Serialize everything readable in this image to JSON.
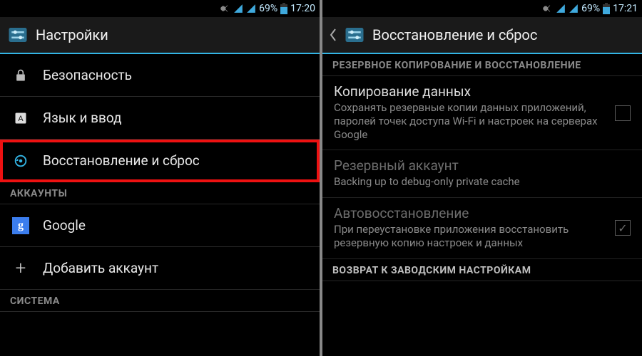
{
  "left": {
    "statusbar": {
      "battery": "69%",
      "time": "17:20"
    },
    "title": "Настройки",
    "rows": {
      "security": "Безопасность",
      "language": "Язык и ввод",
      "backup_reset": "Восстановление и сброс"
    },
    "cat_accounts": "АККАУНТЫ",
    "account_google": "Google",
    "add_account": "Добавить аккаунт",
    "cat_system": "СИСТЕМА"
  },
  "right": {
    "statusbar": {
      "battery": "69%",
      "time": "17:21"
    },
    "title": "Восстановление и сброс",
    "cat_backup": "РЕЗЕРВНОЕ КОПИРОВАНИЕ И ВОССТАНОВЛЕНИЕ",
    "backup_data": {
      "title": "Копирование данных",
      "summary": "Сохранять резервные копии данных приложений, паролей точек доступа Wi-Fi и настроек на серверах Google"
    },
    "backup_account": {
      "title": "Резервный аккаунт",
      "summary": "Backing up to debug-only private cache"
    },
    "auto_restore": {
      "title": "Автовосстановление",
      "summary": "При переустановке приложения восстановить резервную копию настроек и данных"
    },
    "cat_reset": "ВОЗВРАТ К ЗАВОДСКИМ НАСТРОЙКАМ"
  }
}
